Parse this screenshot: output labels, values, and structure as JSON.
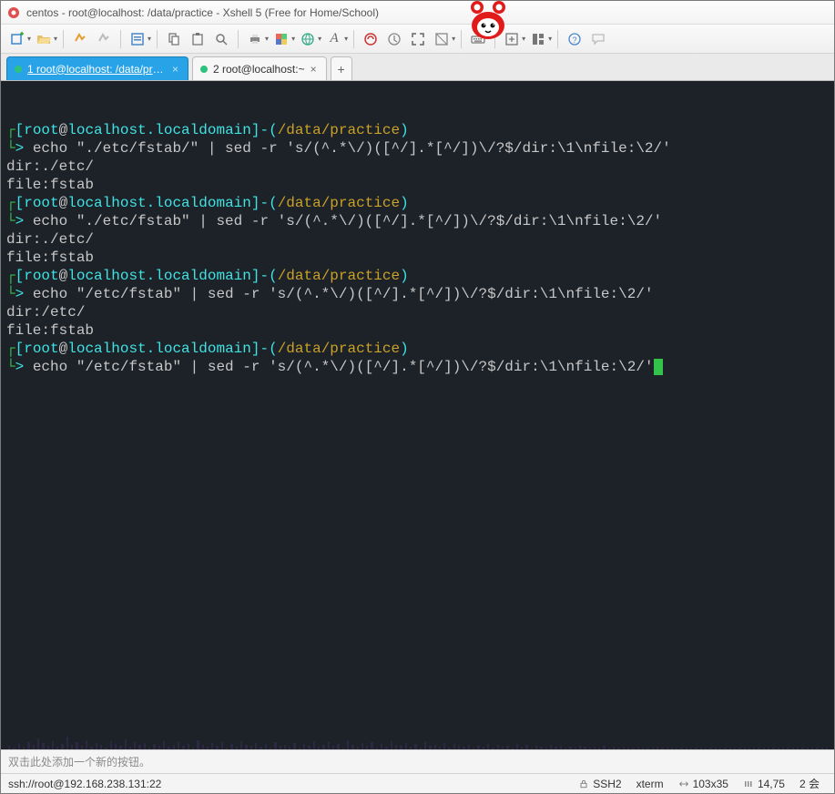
{
  "window": {
    "title": "centos - root@localhost: /data/practice - Xshell 5 (Free for Home/School)"
  },
  "tabs": [
    {
      "label": "1 root@localhost: /data/prac...",
      "active": true
    },
    {
      "label": "2 root@localhost:~",
      "active": false
    }
  ],
  "prompt": {
    "user": "root",
    "at": "@",
    "host": "localhost.localdomain",
    "sep1": "]-(",
    "path": "/data/practice",
    "close": ")",
    "open": "[",
    "arrow": ">"
  },
  "blocks": [
    {
      "cmd": " echo \"./etc/fstab/\" | sed -r 's/(^.*\\/)([^/].*[^/])\\/?$/dir:\\1\\nfile:\\2/'",
      "out": [
        "dir:./etc/",
        "file:fstab"
      ]
    },
    {
      "cmd": " echo \"./etc/fstab\" | sed -r 's/(^.*\\/)([^/].*[^/])\\/?$/dir:\\1\\nfile:\\2/'",
      "out": [
        "dir:./etc/",
        "file:fstab"
      ]
    },
    {
      "cmd": " echo \"/etc/fstab\" | sed -r 's/(^.*\\/)([^/].*[^/])\\/?$/dir:\\1\\nfile:\\2/'",
      "out": [
        "dir:/etc/",
        "file:fstab"
      ]
    },
    {
      "cmd": " echo \"/etc/fstab\" | sed -r 's/(^.*\\/)([^/].*[^/])\\/?$/dir:\\1\\nfile:\\2/'",
      "out": [],
      "cursor": true
    }
  ],
  "buttonarea": {
    "hint": "双击此处添加一个新的按钮。"
  },
  "status": {
    "conn": "ssh://root@192.168.238.131:22",
    "proto": "SSH2",
    "term": "xterm",
    "size": "103x35",
    "pos": "14,75",
    "sess": "2 会"
  },
  "icons": {
    "app": "app-icon",
    "newtab": "new-tab-icon",
    "open": "open-icon",
    "reconnect": "reconnect-icon",
    "disconnect": "disconnect-icon",
    "props": "properties-icon",
    "copy": "copy-icon",
    "paste": "paste-icon",
    "find": "find-icon",
    "print": "print-icon",
    "color": "color-icon",
    "globe": "globe-icon",
    "font": "font-icon",
    "xagent": "xagent-icon",
    "xftp": "xftp-icon",
    "fullscreen": "fullscreen-icon",
    "transparent": "transparent-icon",
    "keyboard": "keyboard-icon",
    "addpane": "add-pane-icon",
    "layout": "layout-icon",
    "help": "help-icon",
    "chat": "chat-icon",
    "lock": "lock-icon",
    "resize": "resize-icon",
    "caret": "caret-icon"
  }
}
